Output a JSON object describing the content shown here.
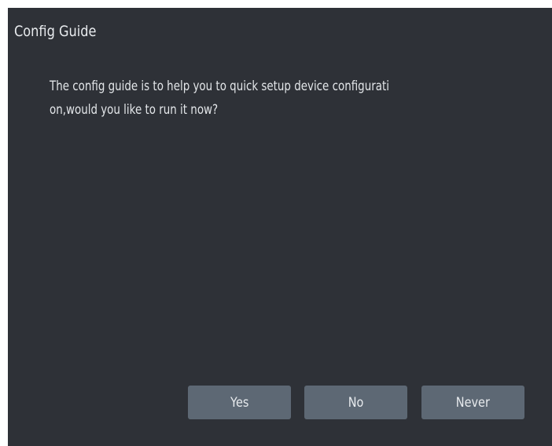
{
  "dialog": {
    "title": "Config Guide",
    "message_lines": [
      "The config guide is to help you to quick setup device configurati",
      "on,would you like to run it now?"
    ],
    "buttons": {
      "yes": "Yes",
      "no": "No",
      "never": "Never"
    }
  },
  "colors": {
    "dialog_background": "#2e3137",
    "button_background": "#5d6874",
    "text": "#e3e6e9"
  }
}
